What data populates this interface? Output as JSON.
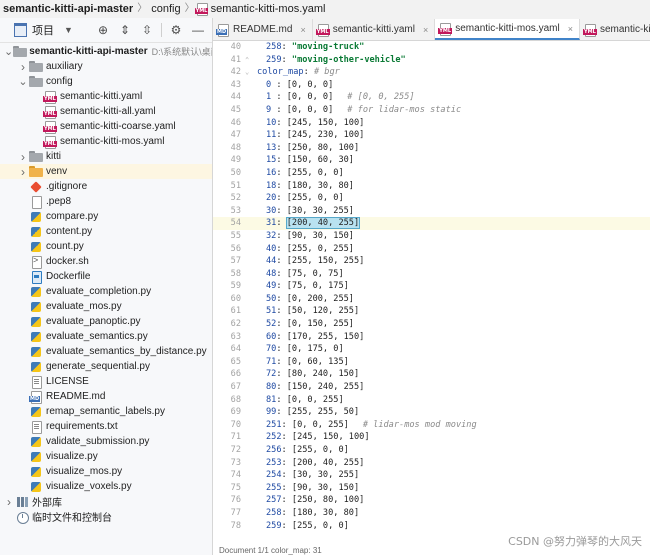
{
  "breadcrumb": {
    "project": "semantic-kitti-api-master",
    "folder": "config",
    "file": "semantic-kitti-mos.yaml"
  },
  "project_panel": {
    "title": "项目",
    "icons": [
      "target-icon",
      "expand-all-icon",
      "collapse-all-icon",
      "gear-icon",
      "minimize-icon"
    ]
  },
  "tree": [
    {
      "label": "semantic-kitti-api-master",
      "hint": "D:\\系统默认\\桌面\\...",
      "level": 0,
      "arrow": "open",
      "icon": "folder",
      "bold": true
    },
    {
      "label": "auxiliary",
      "level": 1,
      "arrow": "closed",
      "icon": "folder"
    },
    {
      "label": "config",
      "level": 1,
      "arrow": "open",
      "icon": "folder"
    },
    {
      "label": "semantic-kitti.yaml",
      "level": 2,
      "icon": "yml"
    },
    {
      "label": "semantic-kitti-all.yaml",
      "level": 2,
      "icon": "yml"
    },
    {
      "label": "semantic-kitti-coarse.yaml",
      "level": 2,
      "icon": "yml"
    },
    {
      "label": "semantic-kitti-mos.yaml",
      "level": 2,
      "icon": "yml"
    },
    {
      "label": "kitti",
      "level": 1,
      "arrow": "closed",
      "icon": "folder"
    },
    {
      "label": "venv",
      "level": 1,
      "arrow": "closed",
      "icon": "venv",
      "selected": true
    },
    {
      "label": ".gitignore",
      "level": 1,
      "icon": "git"
    },
    {
      "label": ".pep8",
      "level": 1,
      "icon": "plain"
    },
    {
      "label": "compare.py",
      "level": 1,
      "icon": "py"
    },
    {
      "label": "content.py",
      "level": 1,
      "icon": "py"
    },
    {
      "label": "count.py",
      "level": 1,
      "icon": "py"
    },
    {
      "label": "docker.sh",
      "level": 1,
      "icon": "sh"
    },
    {
      "label": "Dockerfile",
      "level": 1,
      "icon": "docker"
    },
    {
      "label": "evaluate_completion.py",
      "level": 1,
      "icon": "py"
    },
    {
      "label": "evaluate_mos.py",
      "level": 1,
      "icon": "py"
    },
    {
      "label": "evaluate_panoptic.py",
      "level": 1,
      "icon": "py"
    },
    {
      "label": "evaluate_semantics.py",
      "level": 1,
      "icon": "py"
    },
    {
      "label": "evaluate_semantics_by_distance.py",
      "level": 1,
      "icon": "py"
    },
    {
      "label": "generate_sequential.py",
      "level": 1,
      "icon": "py"
    },
    {
      "label": "LICENSE",
      "level": 1,
      "icon": "txt"
    },
    {
      "label": "README.md",
      "level": 1,
      "icon": "md"
    },
    {
      "label": "remap_semantic_labels.py",
      "level": 1,
      "icon": "py"
    },
    {
      "label": "requirements.txt",
      "level": 1,
      "icon": "txt"
    },
    {
      "label": "validate_submission.py",
      "level": 1,
      "icon": "py"
    },
    {
      "label": "visualize.py",
      "level": 1,
      "icon": "py"
    },
    {
      "label": "visualize_mos.py",
      "level": 1,
      "icon": "py"
    },
    {
      "label": "visualize_voxels.py",
      "level": 1,
      "icon": "py"
    },
    {
      "label": "外部库",
      "level": 0,
      "arrow": "closed",
      "icon": "lib"
    },
    {
      "label": "临时文件和控制台",
      "level": 0,
      "icon": "scratch"
    }
  ],
  "tabs": [
    {
      "label": "README.md",
      "icon": "md",
      "active": false
    },
    {
      "label": "semantic-kitti.yaml",
      "icon": "yml",
      "active": false
    },
    {
      "label": "semantic-kitti-mos.yaml",
      "icon": "yml",
      "active": true
    },
    {
      "label": "semantic-kitti-coarse.yaml",
      "icon": "yml",
      "active": false
    }
  ],
  "code_lines": [
    {
      "n": "40",
      "key": "258",
      "val": "\"moving-truck\"",
      "indent": 2,
      "type": "str"
    },
    {
      "n": "41",
      "key": "259",
      "val": "\"moving-other-vehicle\"",
      "indent": 2,
      "type": "str",
      "fold": true
    },
    {
      "n": "42",
      "key": "color_map",
      "comment": "# bgr",
      "indent": 0,
      "type": "head"
    },
    {
      "n": "43",
      "key": "0 ",
      "val": "[0, 0, 0]",
      "indent": 2,
      "type": "list"
    },
    {
      "n": "44",
      "key": "1 ",
      "val": "[0, 0, 0]",
      "comment": "# [0, 0, 255]",
      "indent": 2,
      "type": "list"
    },
    {
      "n": "45",
      "key": "9 ",
      "val": "[0, 0, 0]",
      "comment": "# for lidar-mos static",
      "indent": 2,
      "type": "list"
    },
    {
      "n": "46",
      "key": "10",
      "val": "[245, 150, 100]",
      "indent": 2,
      "type": "list"
    },
    {
      "n": "47",
      "key": "11",
      "val": "[245, 230, 100]",
      "indent": 2,
      "type": "list"
    },
    {
      "n": "48",
      "key": "13",
      "val": "[250, 80, 100]",
      "indent": 2,
      "type": "list"
    },
    {
      "n": "49",
      "key": "15",
      "val": "[150, 60, 30]",
      "indent": 2,
      "type": "list"
    },
    {
      "n": "50",
      "key": "16",
      "val": "[255, 0, 0]",
      "indent": 2,
      "type": "list"
    },
    {
      "n": "51",
      "key": "18",
      "val": "[180, 30, 80]",
      "indent": 2,
      "type": "list"
    },
    {
      "n": "52",
      "key": "20",
      "val": "[255, 0, 0]",
      "indent": 2,
      "type": "list"
    },
    {
      "n": "53",
      "key": "30",
      "val": "[30, 30, 255]",
      "indent": 2,
      "type": "list"
    },
    {
      "n": "54",
      "key": "31",
      "val": "[200, 40, 255]",
      "indent": 2,
      "type": "list",
      "current": true
    },
    {
      "n": "55",
      "key": "32",
      "val": "[90, 30, 150]",
      "indent": 2,
      "type": "list"
    },
    {
      "n": "56",
      "key": "40",
      "val": "[255, 0, 255]",
      "indent": 2,
      "type": "list"
    },
    {
      "n": "57",
      "key": "44",
      "val": "[255, 150, 255]",
      "indent": 2,
      "type": "list"
    },
    {
      "n": "58",
      "key": "48",
      "val": "[75, 0, 75]",
      "indent": 2,
      "type": "list"
    },
    {
      "n": "59",
      "key": "49",
      "val": "[75, 0, 175]",
      "indent": 2,
      "type": "list"
    },
    {
      "n": "60",
      "key": "50",
      "val": "[0, 200, 255]",
      "indent": 2,
      "type": "list"
    },
    {
      "n": "61",
      "key": "51",
      "val": "[50, 120, 255]",
      "indent": 2,
      "type": "list"
    },
    {
      "n": "62",
      "key": "52",
      "val": "[0, 150, 255]",
      "indent": 2,
      "type": "list"
    },
    {
      "n": "63",
      "key": "60",
      "val": "[170, 255, 150]",
      "indent": 2,
      "type": "list"
    },
    {
      "n": "64",
      "key": "70",
      "val": "[0, 175, 0]",
      "indent": 2,
      "type": "list"
    },
    {
      "n": "65",
      "key": "71",
      "val": "[0, 60, 135]",
      "indent": 2,
      "type": "list"
    },
    {
      "n": "66",
      "key": "72",
      "val": "[80, 240, 150]",
      "indent": 2,
      "type": "list"
    },
    {
      "n": "67",
      "key": "80",
      "val": "[150, 240, 255]",
      "indent": 2,
      "type": "list"
    },
    {
      "n": "68",
      "key": "81",
      "val": "[0, 0, 255]",
      "indent": 2,
      "type": "list"
    },
    {
      "n": "69",
      "key": "99",
      "val": "[255, 255, 50]",
      "indent": 2,
      "type": "list"
    },
    {
      "n": "70",
      "key": "251",
      "val": "[0, 0, 255]",
      "comment": "# lidar-mos mod moving",
      "indent": 2,
      "type": "list"
    },
    {
      "n": "71",
      "key": "252",
      "val": "[245, 150, 100]",
      "indent": 2,
      "type": "list"
    },
    {
      "n": "72",
      "key": "256",
      "val": "[255, 0, 0]",
      "indent": 2,
      "type": "list"
    },
    {
      "n": "73",
      "key": "253",
      "val": "[200, 40, 255]",
      "indent": 2,
      "type": "list"
    },
    {
      "n": "74",
      "key": "254",
      "val": "[30, 30, 255]",
      "indent": 2,
      "type": "list"
    },
    {
      "n": "75",
      "key": "255",
      "val": "[90, 30, 150]",
      "indent": 2,
      "type": "list"
    },
    {
      "n": "76",
      "key": "257",
      "val": "[250, 80, 100]",
      "indent": 2,
      "type": "list"
    },
    {
      "n": "77",
      "key": "258",
      "val": "[180, 30, 80]",
      "indent": 2,
      "type": "list"
    },
    {
      "n": "78",
      "key": "259",
      "val": "[255, 0, 0]",
      "indent": 2,
      "type": "list"
    }
  ],
  "status_text": "Document 1/1  color_map:  31",
  "watermark": "CSDN @努力弹琴的大风天",
  "colors": {
    "accent": "#4083c9",
    "selected_row": "#fdf6e2",
    "current_line": "#fcfae4"
  }
}
